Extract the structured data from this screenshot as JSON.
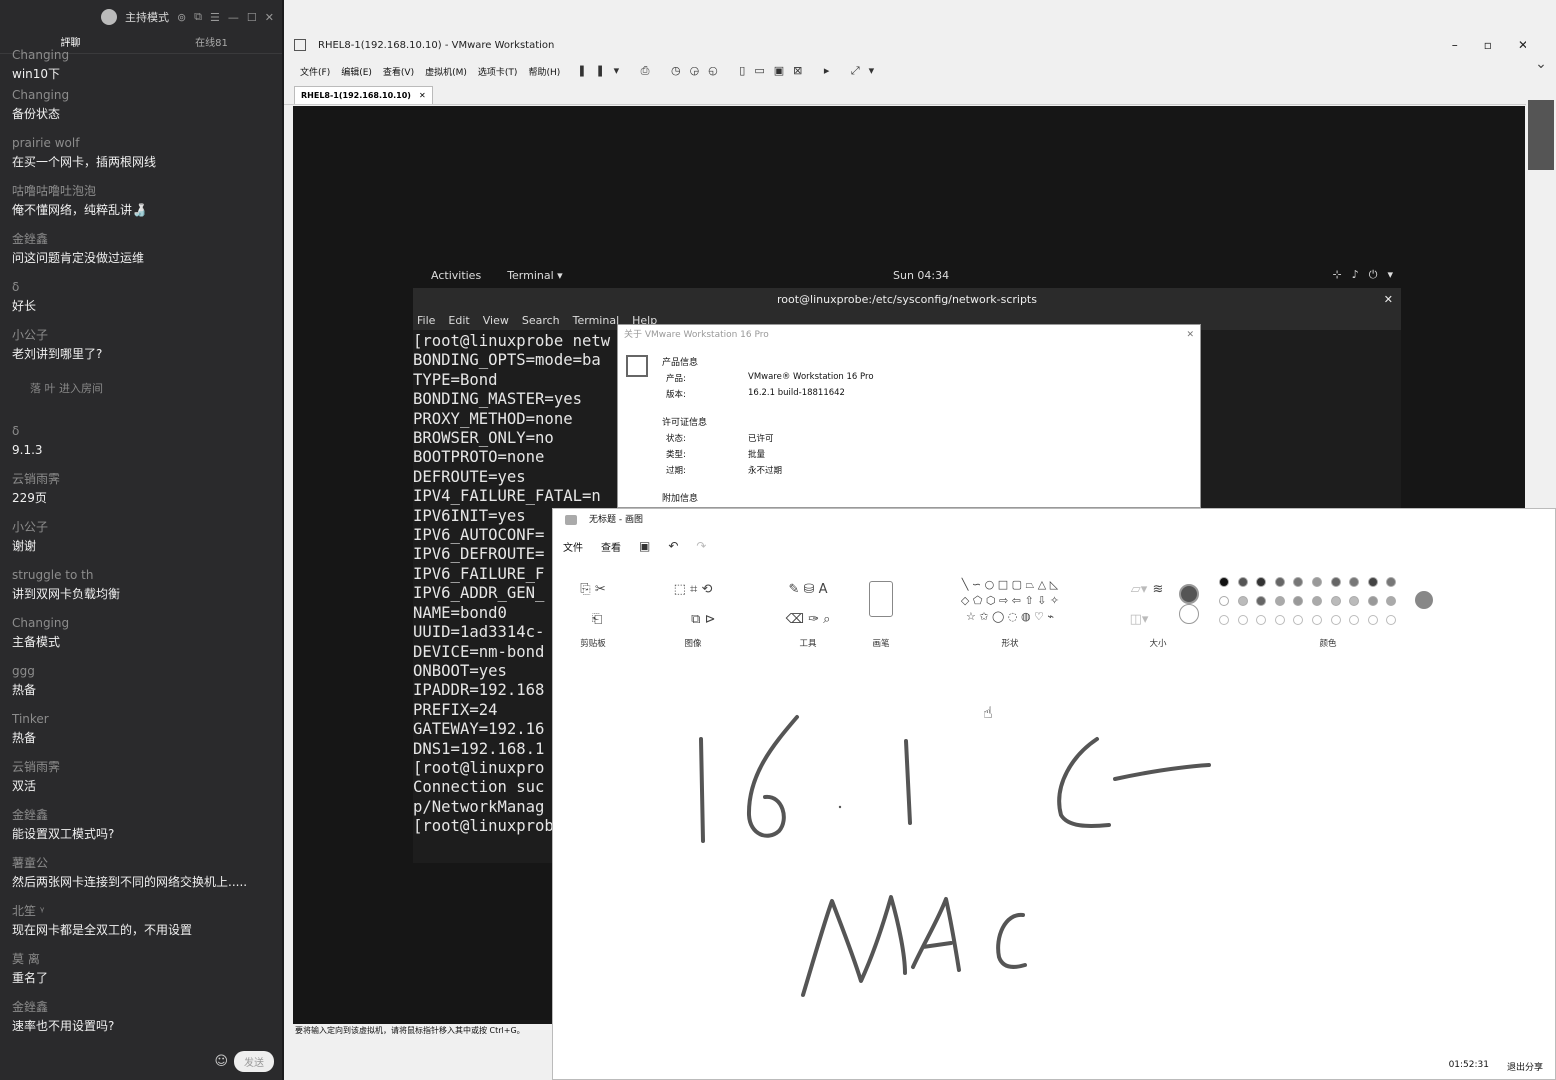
{
  "chat": {
    "top_label": "主持模式",
    "tabs": [
      "評聊",
      "在线81"
    ],
    "messages": [
      {
        "user": "Changing",
        "text": "win10下"
      },
      {
        "user": "Changing",
        "text": "备份状态"
      },
      {
        "user": "prairie wolf",
        "text": "在买一个网卡，插两根网线"
      },
      {
        "user": "咕噜咕噜吐泡泡",
        "text": "俺不懂网络，纯粹乱讲🍶"
      },
      {
        "user": "金銼鑫",
        "text": "问这问题肯定没做过运维"
      },
      {
        "user": "δ",
        "text": "好长"
      },
      {
        "user": "小公子",
        "text": "老刘讲到哪里了?"
      }
    ],
    "system_message": "落    叶 进入房间",
    "messages2": [
      {
        "user": "δ",
        "text": "9.1.3"
      },
      {
        "user": "云销雨霁",
        "text": "229页"
      },
      {
        "user": "小公子",
        "text": "谢谢"
      },
      {
        "user": "struggle to th",
        "text": "讲到双网卡负载均衡"
      },
      {
        "user": "Changing",
        "text": "主备模式"
      },
      {
        "user": "ggg",
        "text": "热备"
      },
      {
        "user": "Tinker",
        "text": "热备"
      },
      {
        "user": "云销雨霁",
        "text": "双活"
      },
      {
        "user": "金銼鑫",
        "text": "能设置双工模式吗?"
      },
      {
        "user": "薯童公",
        "text": "然后两张网卡连接到不同的网络交换机上....."
      },
      {
        "user": "北笙 ᵞ",
        "text": "现在网卡都是全双工的，不用设置"
      },
      {
        "user": "莫 离",
        "text": "重名了"
      },
      {
        "user": "金銼鑫",
        "text": "速率也不用设置吗?"
      }
    ],
    "send_label": "发送"
  },
  "vmware": {
    "title": "RHEL8-1(192.168.10.10) - VMware Workstation",
    "menu": [
      "文件(F)",
      "编辑(E)",
      "查看(V)",
      "虚拟机(M)",
      "选项卡(T)",
      "帮助(H)"
    ],
    "tab_label": "RHEL8-1(192.168.10.10)",
    "status_hint": "要将输入定向到该虚拟机，请将鼠标指针移入其中或按 Ctrl+G。"
  },
  "gnome": {
    "activities": "Activities",
    "app": "Terminal ▾",
    "clock": "Sun 04:34"
  },
  "terminal": {
    "title": "root@linuxprobe:/etc/sysconfig/network-scripts",
    "menu": [
      "File",
      "Edit",
      "View",
      "Search",
      "Terminal",
      "Help"
    ],
    "lines": [
      "[root@linuxprobe netw",
      "BONDING_OPTS=mode=ba",
      "TYPE=Bond",
      "BONDING_MASTER=yes",
      "PROXY_METHOD=none",
      "BROWSER_ONLY=no",
      "BOOTPROTO=none",
      "DEFROUTE=yes",
      "IPV4_FAILURE_FATAL=n",
      "IPV6INIT=yes",
      "IPV6_AUTOCONF=",
      "IPV6_DEFROUTE=",
      "IPV6_FAILURE_F",
      "IPV6_ADDR_GEN_",
      "NAME=bond0",
      "UUID=1ad3314c-",
      "DEVICE=nm-bond",
      "ONBOOT=yes",
      "IPADDR=192.168",
      "PREFIX=24",
      "GATEWAY=192.16",
      "DNS1=192.168.1",
      "[root@linuxpro",
      "Connection suc",
      "p/NetworkManag",
      "[root@linuxprob"
    ]
  },
  "about": {
    "title": "关于 VMware Workstation 16 Pro",
    "product_section": "产品信息",
    "product_key": "产品:",
    "product_val": "VMware® Workstation 16 Pro",
    "version_key": "版本:",
    "version_val": "16.2.1 build-18811642",
    "license_section": "许可证信息",
    "status_key": "状态:",
    "status_val": "已许可",
    "type_key": "类型:",
    "type_val": "批量",
    "expire_key": "过期:",
    "expire_val": "永不过期",
    "extra_section": "附加信息"
  },
  "paint": {
    "title": "无标题 - 画图",
    "menu": [
      "文件",
      "查看"
    ],
    "groups": [
      "剪贴板",
      "图像",
      "工具",
      "画笔",
      "形状",
      "大小",
      "颜色"
    ],
    "palette_colors": [
      "#111111",
      "#555555",
      "#333333",
      "#666666",
      "#777777",
      "#999999",
      "#666666",
      "#777777",
      "#444444",
      "#777777"
    ],
    "palette_row2": [
      "#ffffff",
      "#bbbbbb",
      "#666666",
      "#aaaaaa",
      "#999999",
      "#aaaaaa",
      "#bbbbbb",
      "#bbbbbb",
      "#999999",
      "#aaaaaa"
    ],
    "handwriting": [
      "16 1",
      "MAC"
    ],
    "timer": "01:52:31",
    "exit_share": "退出分享"
  }
}
